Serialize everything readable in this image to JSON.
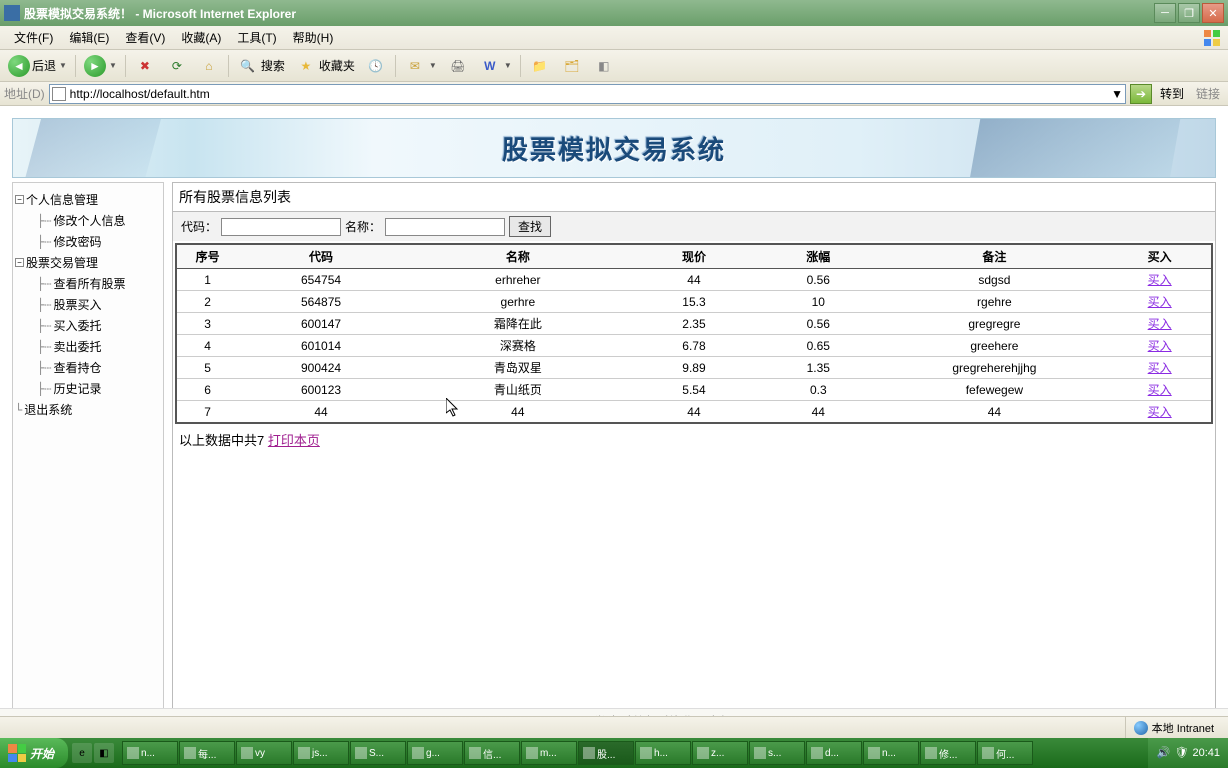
{
  "window": {
    "title": "股票模拟交易系统！ - Microsoft Internet Explorer"
  },
  "menubar": {
    "file": "文件(F)",
    "edit": "编辑(E)",
    "view": "查看(V)",
    "favorites": "收藏(A)",
    "tools": "工具(T)",
    "help": "帮助(H)"
  },
  "toolbar": {
    "back": "后退",
    "search": "搜索",
    "favorites": "收藏夹"
  },
  "addressbar": {
    "label": "地址(D)",
    "url": "http://localhost/default.htm",
    "goto": "转到",
    "links": "链接"
  },
  "banner": {
    "title": "股票模拟交易系统"
  },
  "sidebar": {
    "nodes": [
      {
        "label": "个人信息管理",
        "level": 0,
        "expandable": true
      },
      {
        "label": "修改个人信息",
        "level": 1
      },
      {
        "label": "修改密码",
        "level": 1
      },
      {
        "label": "股票交易管理",
        "level": 0,
        "expandable": true
      },
      {
        "label": "查看所有股票",
        "level": 1
      },
      {
        "label": "股票买入",
        "level": 1
      },
      {
        "label": "买入委托",
        "level": 1
      },
      {
        "label": "卖出委托",
        "level": 1
      },
      {
        "label": "查看持仓",
        "level": 1
      },
      {
        "label": "历史记录",
        "level": 1
      },
      {
        "label": "退出系统",
        "level": 0
      }
    ]
  },
  "panel": {
    "title": "所有股票信息列表",
    "code_label": "代码：",
    "name_label": "名称：",
    "search_btn": "查找",
    "columns": [
      "序号",
      "代码",
      "名称",
      "现价",
      "涨幅",
      "备注",
      "买入"
    ],
    "rows": [
      {
        "idx": "1",
        "code": "654754",
        "name": "erhreher",
        "price": "44",
        "change": "0.56",
        "note": "sdgsd",
        "buy": "买入"
      },
      {
        "idx": "2",
        "code": "564875",
        "name": "gerhre",
        "price": "15.3",
        "change": "10",
        "note": "rgehre",
        "buy": "买入"
      },
      {
        "idx": "3",
        "code": "600147",
        "name": "霜降在此",
        "price": "2.35",
        "change": "0.56",
        "note": "gregregre",
        "buy": "买入"
      },
      {
        "idx": "4",
        "code": "601014",
        "name": "深赛格",
        "price": "6.78",
        "change": "0.65",
        "note": "greehere",
        "buy": "买入"
      },
      {
        "idx": "5",
        "code": "900424",
        "name": "青岛双星",
        "price": "9.89",
        "change": "1.35",
        "note": "gregreherehjjhg",
        "buy": "买入"
      },
      {
        "idx": "6",
        "code": "600123",
        "name": "青山纸页",
        "price": "5.54",
        "change": "0.3",
        "note": "fefewegew",
        "buy": "买入"
      },
      {
        "idx": "7",
        "code": "44",
        "name": "44",
        "price": "44",
        "change": "44",
        "note": "44",
        "buy": "买入"
      }
    ],
    "footer_prefix": "以上数据中共7 ",
    "print_link": "打印本页"
  },
  "copyright": "Copyright(C) xxxxxx学院 计算机系毕业设计专用",
  "statusbar": {
    "zone": "本地 Intranet"
  },
  "taskbar": {
    "start": "开始",
    "tasks": [
      "n...",
      "每...",
      "vy",
      "js...",
      "S...",
      "g...",
      "信...",
      "m...",
      "股...",
      "h...",
      "z...",
      "s...",
      "d...",
      "n...",
      "修...",
      "何..."
    ],
    "active_index": 8,
    "clock": "20:41"
  }
}
